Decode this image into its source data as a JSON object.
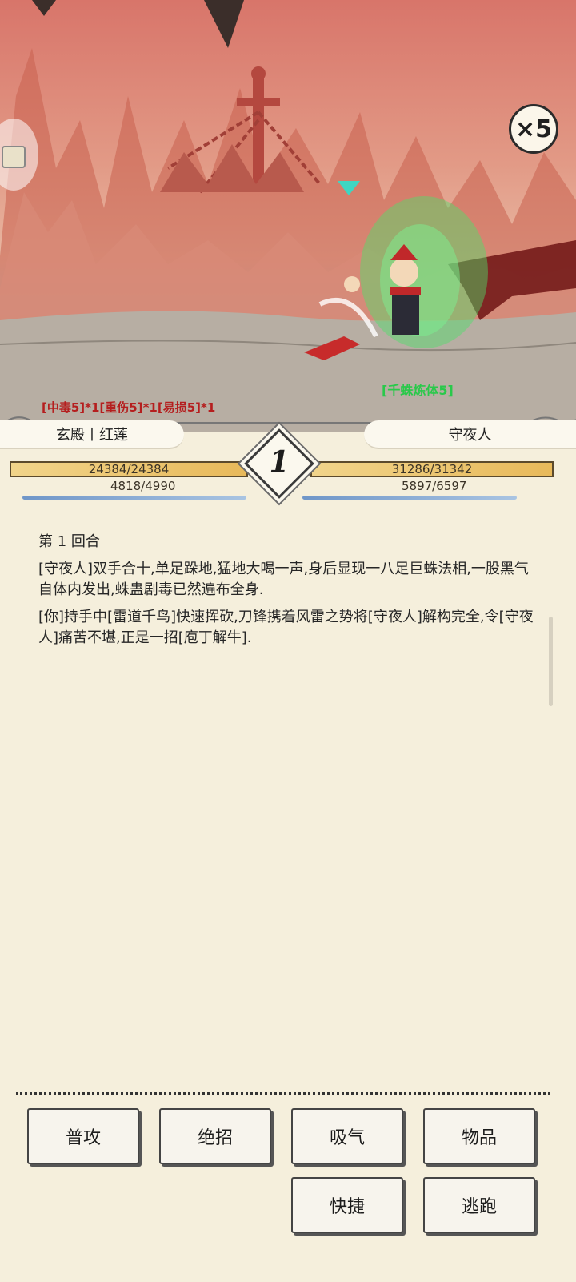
{
  "battle": {
    "speed_multiplier": "×5",
    "left_status_effects": "[中毒5]*1[重伤5]*1[易损5]*1",
    "right_status_effects": "[千蛛炼体5]"
  },
  "player": {
    "name": "玄殿丨红莲",
    "hp_text": "24384/24384",
    "hp_fraction": 1.0,
    "mp_text": "4818/4990",
    "mp_fraction": 0.966
  },
  "enemy": {
    "name": "守夜人",
    "hp_text": "31286/31342",
    "hp_fraction": 0.998,
    "mp_text": "5897/6597",
    "mp_fraction": 0.894
  },
  "round": {
    "number": "1"
  },
  "log": {
    "entries": [
      "第 1 回合",
      "[守夜人]双手合十,单足跺地,猛地大喝一声,身后显现一八足巨蛛法相,一股黑气自体内发出,蛛蛊剧毒已然遍布全身.",
      "[你]持手中[雷道千鸟]快速挥砍,刀锋携着风雷之势将[守夜人]解构完全,令[守夜人]痛苦不堪,正是一招[庖丁解牛]."
    ]
  },
  "actions": {
    "attack": "普攻",
    "ultimate": "绝招",
    "breathe": "吸气",
    "items": "物品",
    "quick": "快捷",
    "flee": "逃跑"
  }
}
